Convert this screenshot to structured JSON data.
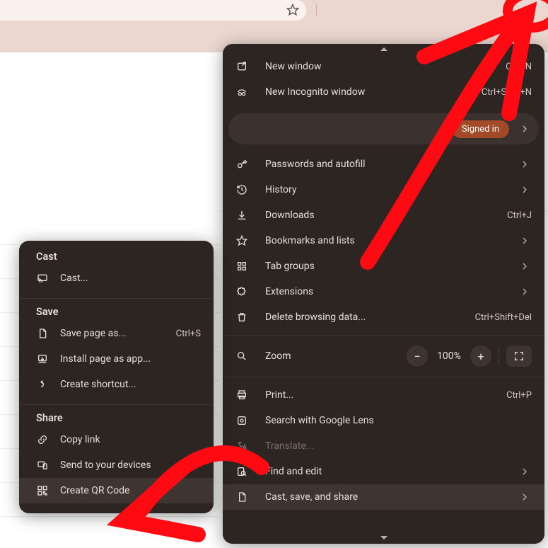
{
  "main_menu": {
    "new_window": {
      "label": "New window",
      "shortcut": "Ctrl+N"
    },
    "new_incognito": {
      "label": "New Incognito window",
      "shortcut": "Ctrl+Shift+N"
    },
    "signed_in": {
      "chip": "Signed in"
    },
    "passwords": {
      "label": "Passwords and autofill"
    },
    "history": {
      "label": "History"
    },
    "downloads": {
      "label": "Downloads",
      "shortcut": "Ctrl+J"
    },
    "bookmarks": {
      "label": "Bookmarks and lists"
    },
    "tab_groups": {
      "label": "Tab groups"
    },
    "extensions": {
      "label": "Extensions"
    },
    "delete_browsing": {
      "label": "Delete browsing data...",
      "shortcut": "Ctrl+Shift+Del"
    },
    "zoom": {
      "label": "Zoom",
      "value": "100%"
    },
    "print": {
      "label": "Print...",
      "shortcut": "Ctrl+P"
    },
    "lens": {
      "label": "Search with Google Lens"
    },
    "translate": {
      "label": "Translate..."
    },
    "find_edit": {
      "label": "Find and edit"
    },
    "cast_save_share": {
      "label": "Cast, save, and share"
    }
  },
  "sub_menu": {
    "cast_section": "Cast",
    "cast": {
      "label": "Cast..."
    },
    "save_section": "Save",
    "save_page": {
      "label": "Save page as...",
      "shortcut": "Ctrl+S"
    },
    "install_app": {
      "label": "Install page as app..."
    },
    "create_shortcut": {
      "label": "Create shortcut..."
    },
    "share_section": "Share",
    "copy_link": {
      "label": "Copy link"
    },
    "send_devices": {
      "label": "Send to your devices"
    },
    "qr_code": {
      "label": "Create QR Code"
    }
  }
}
